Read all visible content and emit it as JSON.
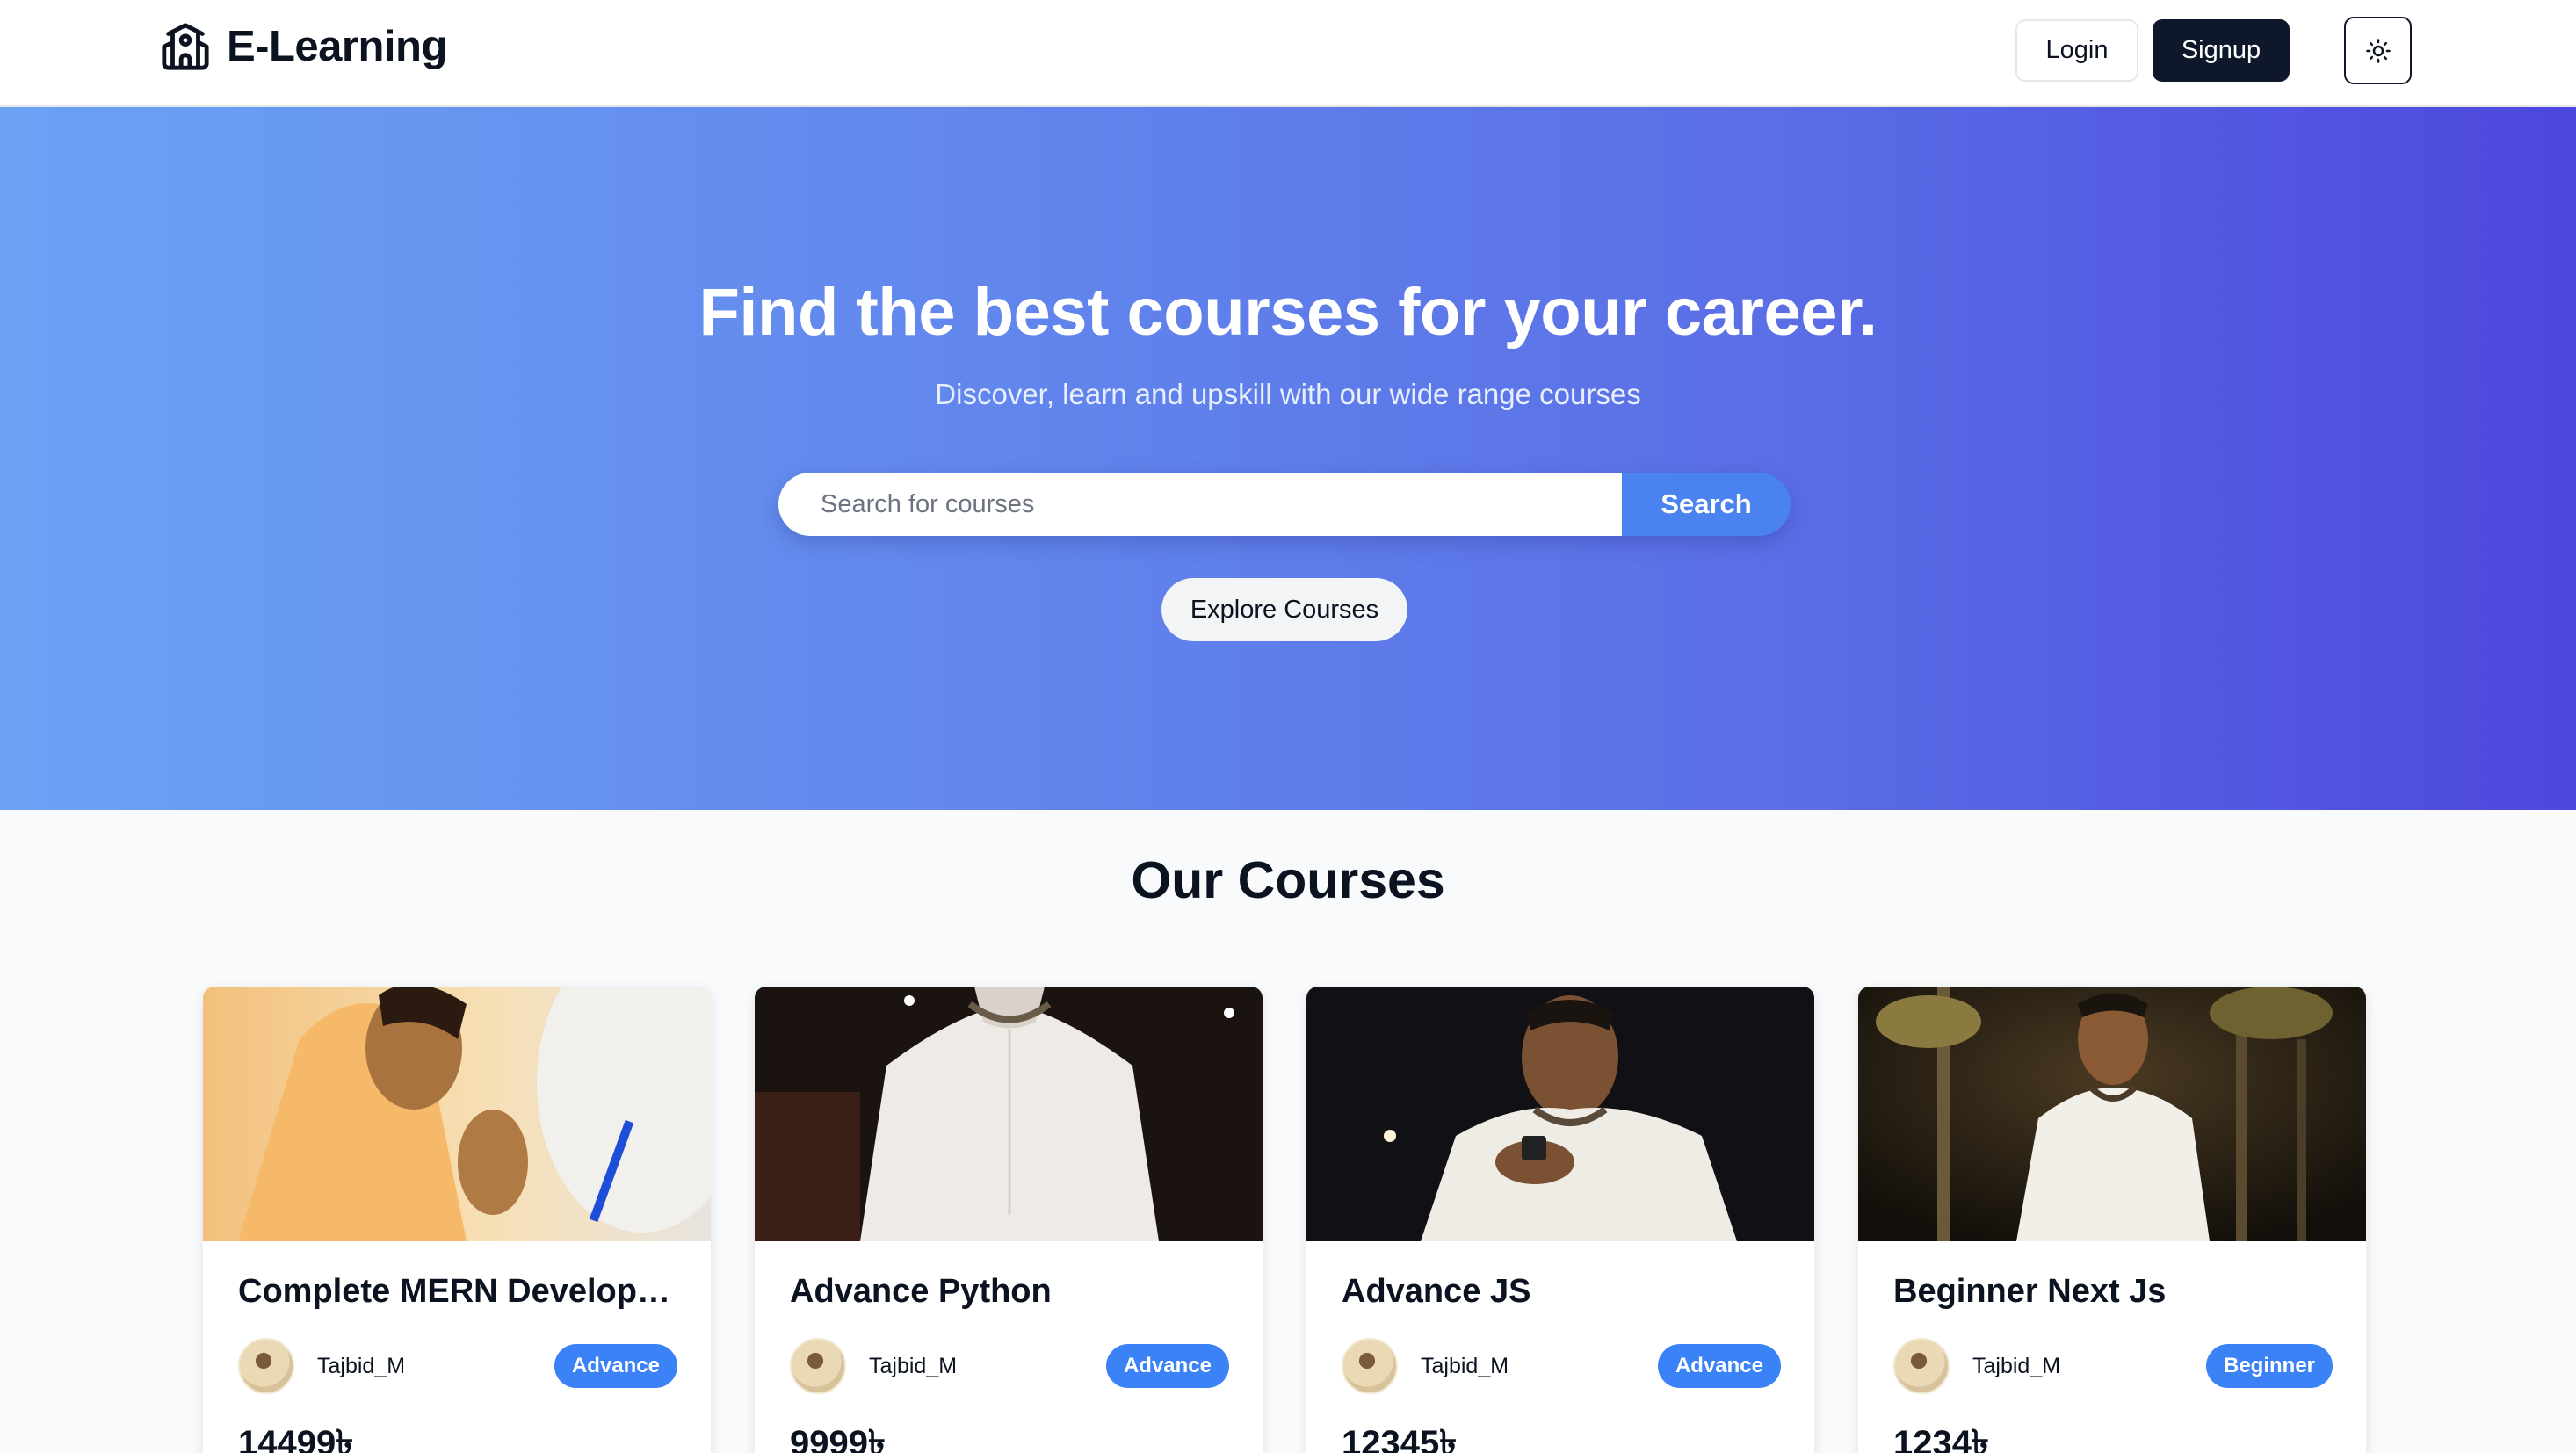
{
  "navbar": {
    "brand": "E-Learning",
    "brand_icon": "school-icon",
    "login_label": "Login",
    "signup_label": "Signup",
    "theme_icon": "sun-icon"
  },
  "hero": {
    "title": "Find the best courses for your career.",
    "subtitle": "Discover, learn and upskill with our wide range courses",
    "search_placeholder": "Search for courses",
    "search_value": "",
    "search_label": "Search",
    "explore_label": "Explore Courses"
  },
  "courses": {
    "title": "Our Courses",
    "items": [
      {
        "title": "Complete MERN Developm...",
        "instructor": "Tajbid_M",
        "level": "Advance",
        "price": "14499৳"
      },
      {
        "title": "Advance Python",
        "instructor": "Tajbid_M",
        "level": "Advance",
        "price": "9999৳"
      },
      {
        "title": "Advance JS",
        "instructor": "Tajbid_M",
        "level": "Advance",
        "price": "12345৳"
      },
      {
        "title": "Beginner Next Js",
        "instructor": "Tajbid_M",
        "level": "Beginner",
        "price": "1234৳"
      }
    ]
  },
  "colors": {
    "brand_dark": "#0f172a",
    "accent": "#3b82f6",
    "hero_gradient_start": "#6ba2f4",
    "hero_gradient_end": "#4d47dd"
  }
}
